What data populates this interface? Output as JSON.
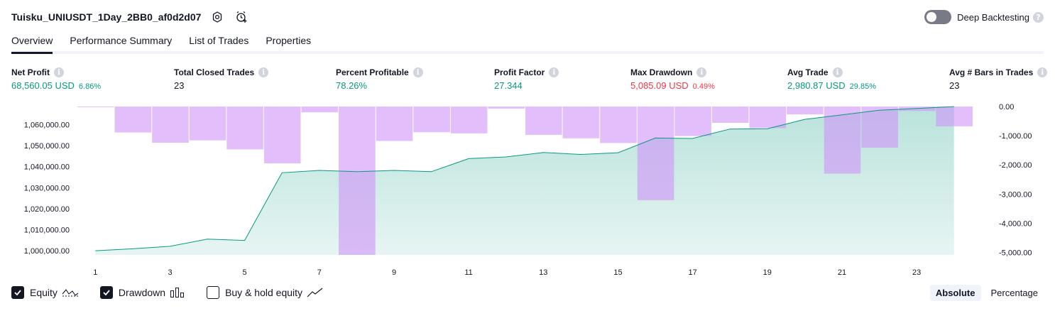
{
  "header": {
    "title": "Tuisku_UNIUSDT_1Day_2BB0_af0d2d07",
    "deep_backtesting_label": "Deep Backtesting"
  },
  "tabs": [
    "Overview",
    "Performance Summary",
    "List of Trades",
    "Properties"
  ],
  "metrics": [
    {
      "label": "Net Profit",
      "value": "68,560.05 USD",
      "sub": "6.86%",
      "color": "#089981"
    },
    {
      "label": "Total Closed Trades",
      "value": "23",
      "sub": "",
      "color": "#131722"
    },
    {
      "label": "Percent Profitable",
      "value": "78.26%",
      "sub": "",
      "color": "#089981"
    },
    {
      "label": "Profit Factor",
      "value": "27.344",
      "sub": "",
      "color": "#089981"
    },
    {
      "label": "Max Drawdown",
      "value": "5,085.09 USD",
      "sub": "0.49%",
      "color": "#f23645"
    },
    {
      "label": "Avg Trade",
      "value": "2,980.87 USD",
      "sub": "29.85%",
      "color": "#089981"
    },
    {
      "label": "Avg # Bars in Trades",
      "value": "23",
      "sub": "",
      "color": "#131722"
    }
  ],
  "legend": {
    "equity_label": "Equity",
    "drawdown_label": "Drawdown",
    "buyhold_label": "Buy & hold equity",
    "equity_checked": true,
    "drawdown_checked": true,
    "buyhold_checked": false
  },
  "modes": {
    "absolute_label": "Absolute",
    "percentage_label": "Percentage",
    "selected": "Absolute"
  },
  "chart_data": {
    "type": "area",
    "x_ticks": [
      "1",
      "3",
      "5",
      "7",
      "9",
      "11",
      "13",
      "15",
      "17",
      "19",
      "21",
      "23"
    ],
    "x": [
      1,
      2,
      3,
      4,
      5,
      6,
      7,
      8,
      9,
      10,
      11,
      12,
      13,
      14,
      15,
      16,
      17,
      18,
      19,
      20,
      21,
      22,
      23,
      24
    ],
    "left_axis": {
      "ticks": [
        "1,000,000.00",
        "1,010,000.00",
        "1,020,000.00",
        "1,030,000.00",
        "1,040,000.00",
        "1,050,000.00",
        "1,060,000.00"
      ],
      "ylim": [
        998000,
        1068600
      ]
    },
    "right_axis": {
      "ticks": [
        "0.00",
        "-1,000.00",
        "-2,000.00",
        "-3,000.00",
        "-4,000.00",
        "-5,000.00"
      ],
      "ylim": [
        -5085,
        0
      ]
    },
    "series": [
      {
        "name": "Equity",
        "type": "area",
        "color": "#089981",
        "values": [
          1000000,
          1000900,
          1002100,
          1005500,
          1004900,
          1037100,
          1038200,
          1037600,
          1038200,
          1037600,
          1043800,
          1044600,
          1046700,
          1045800,
          1046600,
          1053600,
          1053400,
          1057900,
          1058000,
          1062500,
          1064600,
          1066800,
          1067700,
          1068560
        ]
      },
      {
        "name": "Drawdown",
        "type": "bar",
        "color": "#ce93f8",
        "values": [
          -10,
          -890,
          -1240,
          -1160,
          -1470,
          -1950,
          -200,
          -5085,
          -1180,
          -880,
          -920,
          -70,
          -970,
          -1090,
          -1250,
          -3210,
          -1010,
          -560,
          -740,
          -270,
          -2300,
          -1410,
          -150,
          -680
        ]
      }
    ]
  }
}
